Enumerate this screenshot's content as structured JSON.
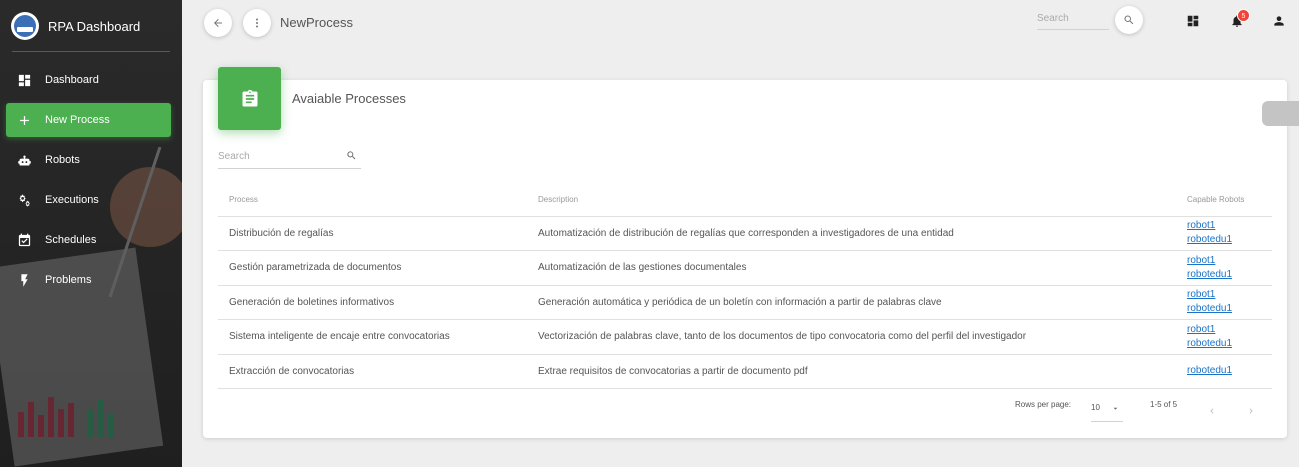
{
  "brand": {
    "title": "RPA Dashboard"
  },
  "sidebar": {
    "items": [
      {
        "label": "Dashboard",
        "icon": "dashboard-icon",
        "active": false
      },
      {
        "label": "New Process",
        "icon": "plus-icon",
        "active": true
      },
      {
        "label": "Robots",
        "icon": "robot-icon",
        "active": false
      },
      {
        "label": "Executions",
        "icon": "gears-icon",
        "active": false
      },
      {
        "label": "Schedules",
        "icon": "calendar-check-icon",
        "active": false
      },
      {
        "label": "Problems",
        "icon": "lightning-icon",
        "active": false
      }
    ]
  },
  "topbar": {
    "title": "NewProcess",
    "search_placeholder": "Search",
    "notification_count": "5"
  },
  "card": {
    "title": "Avaiable Processes",
    "search_placeholder": "Search",
    "columns": {
      "process": "Process",
      "description": "Description",
      "robots": "Capable Robots"
    },
    "rows": [
      {
        "process": "Distribución de regalías",
        "description": "Automatización de distribución de regalías que corresponden a investigadores de una entidad",
        "robots": [
          "robot1",
          "robotedu1"
        ]
      },
      {
        "process": "Gestión parametrizada de documentos",
        "description": "Automatización de las gestiones documentales",
        "robots": [
          "robot1",
          "robotedu1"
        ]
      },
      {
        "process": "Generación de boletines informativos",
        "description": "Generación automática y periódica de un boletín con información a partir de palabras clave",
        "robots": [
          "robot1",
          "robotedu1"
        ]
      },
      {
        "process": "Sistema inteligente de encaje entre convocatorias",
        "description": "Vectorización de palabras clave, tanto de los documentos de tipo convocatoria como del perfil del investigador",
        "robots": [
          "robot1",
          "robotedu1"
        ]
      },
      {
        "process": "Extracción de convocatorias",
        "description": "Extrae requisitos de convocatorias a partir de documento pdf",
        "robots": [
          "robotedu1"
        ]
      }
    ],
    "pagination": {
      "rows_per_page_label": "Rows per page:",
      "rows_per_page": "10",
      "range": "1-5 of 5"
    }
  },
  "colors": {
    "accent": "#4caf50",
    "sidebar_bg": "#262626",
    "link": "#1a73c8",
    "badge": "#f44336"
  }
}
